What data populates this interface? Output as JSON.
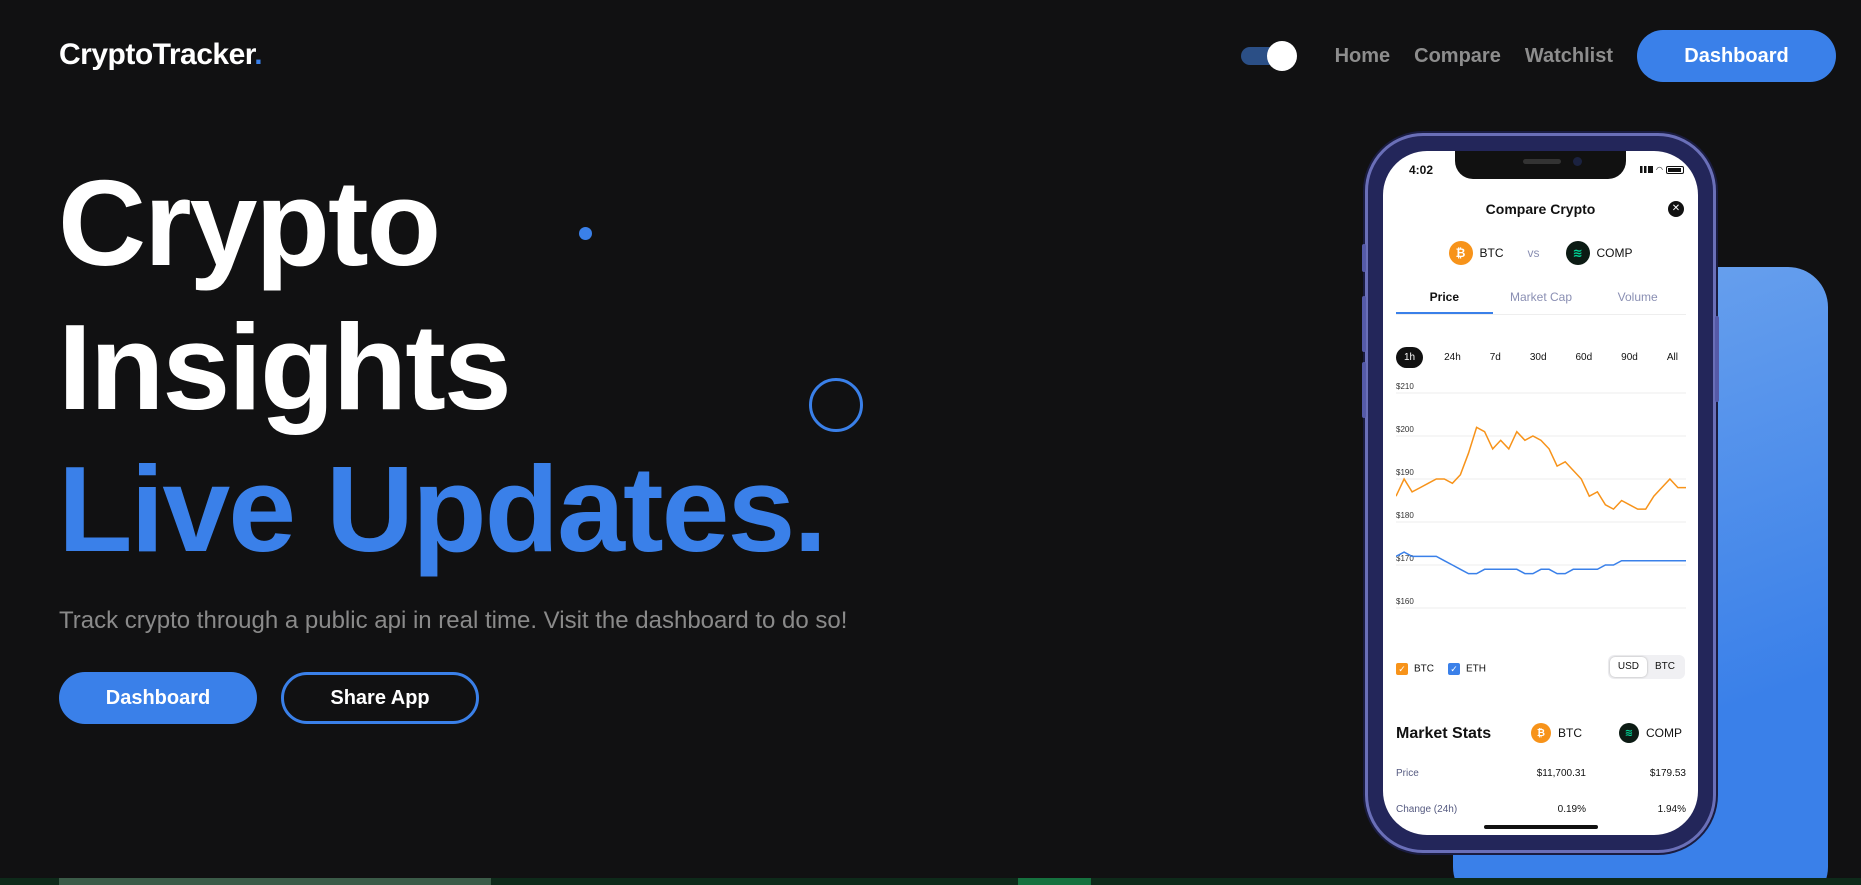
{
  "brand": {
    "name": "CryptoTracker",
    "dot": "."
  },
  "nav": {
    "links": [
      "Home",
      "Compare",
      "Watchlist"
    ],
    "dashboard_label": "Dashboard"
  },
  "hero": {
    "line1": "Crypto",
    "line2": "Insights",
    "line3": "Live Updates.",
    "subtitle": "Track crypto through a public api in real time. Visit the dashboard to do so!",
    "primary_cta": "Dashboard",
    "secondary_cta": "Share App"
  },
  "colors": {
    "accent": "#3a80e9",
    "background": "#111112",
    "btc": "#f7931a",
    "eth": "#3a80e9"
  },
  "phone": {
    "time": "4:02",
    "title": "Compare Crypto",
    "close_icon": "close-icon",
    "coin_a": "BTC",
    "vs": "vs",
    "coin_b": "COMP",
    "tabs": [
      "Price",
      "Market Cap",
      "Volume"
    ],
    "active_tab": "Price",
    "ranges": [
      "1h",
      "24h",
      "7d",
      "30d",
      "60d",
      "90d",
      "All"
    ],
    "active_range": "1h",
    "legend": [
      "BTC",
      "ETH"
    ],
    "currency": [
      "USD",
      "BTC"
    ],
    "active_currency": "USD",
    "market_stats": {
      "title": "Market Stats",
      "col_a": "BTC",
      "col_b": "COMP",
      "rows": [
        {
          "label": "Price",
          "a": "$11,700.31",
          "b": "$179.53"
        },
        {
          "label": "Change (24h)",
          "a": "0.19%",
          "b": "1.94%"
        }
      ]
    }
  },
  "chart_data": {
    "type": "line",
    "ylabels": [
      "$210",
      "$200",
      "$190",
      "$180",
      "$170",
      "$160"
    ],
    "ylim": [
      160,
      210
    ],
    "series": [
      {
        "name": "BTC",
        "color": "#f7931a",
        "values": [
          186,
          190,
          187,
          188,
          189,
          190,
          190,
          189,
          191,
          196,
          202,
          201,
          197,
          199,
          197,
          201,
          199,
          200,
          199,
          197,
          193,
          194,
          192,
          190,
          186,
          187,
          184,
          183,
          185,
          184,
          183,
          183,
          186,
          188,
          190,
          188,
          188
        ]
      },
      {
        "name": "ETH",
        "color": "#3a80e9",
        "values": [
          172,
          173,
          172,
          172,
          172,
          172,
          171,
          170,
          169,
          168,
          168,
          169,
          169,
          169,
          169,
          169,
          168,
          168,
          169,
          169,
          168,
          168,
          169,
          169,
          169,
          169,
          170,
          170,
          171,
          171,
          171,
          171,
          171,
          171,
          171,
          171,
          171
        ]
      }
    ]
  }
}
